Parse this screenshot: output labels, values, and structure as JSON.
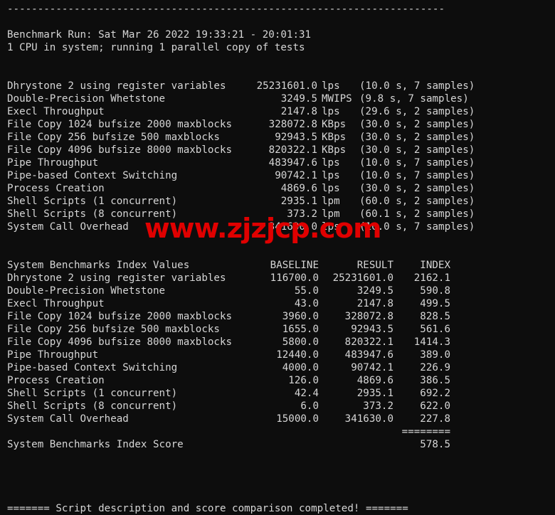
{
  "terminal": {
    "background": "#0d0d0d",
    "foreground": "#d6d6d6",
    "watermark_color": "#e00000",
    "divider_top": "------------------------------------------------------------------------",
    "header": {
      "benchmark_run": "Benchmark Run: Sat Mar 26 2022 19:33:21 - 20:01:31",
      "cpu_line": "1 CPU in system; running 1 parallel copy of tests"
    },
    "watermark": "www.zjzjcp.com",
    "results": [
      {
        "label": "Dhrystone 2 using register variables",
        "value": "25231601.0",
        "unit": "lps",
        "timing": "(10.0 s, 7 samples)"
      },
      {
        "label": "Double-Precision Whetstone",
        "value": "3249.5",
        "unit": "MWIPS",
        "timing": "(9.8 s, 7 samples)"
      },
      {
        "label": "Execl Throughput",
        "value": "2147.8",
        "unit": "lps",
        "timing": "(29.6 s, 2 samples)"
      },
      {
        "label": "File Copy 1024 bufsize 2000 maxblocks",
        "value": "328072.8",
        "unit": "KBps",
        "timing": "(30.0 s, 2 samples)"
      },
      {
        "label": "File Copy 256 bufsize 500 maxblocks",
        "value": "92943.5",
        "unit": "KBps",
        "timing": "(30.0 s, 2 samples)"
      },
      {
        "label": "File Copy 4096 bufsize 8000 maxblocks",
        "value": "820322.1",
        "unit": "KBps",
        "timing": "(30.0 s, 2 samples)"
      },
      {
        "label": "Pipe Throughput",
        "value": "483947.6",
        "unit": "lps",
        "timing": "(10.0 s, 7 samples)"
      },
      {
        "label": "Pipe-based Context Switching",
        "value": "90742.1",
        "unit": "lps",
        "timing": "(10.0 s, 7 samples)"
      },
      {
        "label": "Process Creation",
        "value": "4869.6",
        "unit": "lps",
        "timing": "(30.0 s, 2 samples)"
      },
      {
        "label": "Shell Scripts (1 concurrent)",
        "value": "2935.1",
        "unit": "lpm",
        "timing": "(60.0 s, 2 samples)"
      },
      {
        "label": "Shell Scripts (8 concurrent)",
        "value": "373.2",
        "unit": "lpm",
        "timing": "(60.1 s, 2 samples)"
      },
      {
        "label": "System Call Overhead",
        "value": "341630.0",
        "unit": "lps",
        "timing": "(10.0 s, 7 samples)"
      }
    ],
    "index_table": {
      "title": "System Benchmarks Index Values",
      "columns": {
        "baseline": "BASELINE",
        "result": "RESULT",
        "index": "INDEX"
      },
      "rows": [
        {
          "label": "Dhrystone 2 using register variables",
          "baseline": "116700.0",
          "result": "25231601.0",
          "index": "2162.1"
        },
        {
          "label": "Double-Precision Whetstone",
          "baseline": "55.0",
          "result": "3249.5",
          "index": "590.8"
        },
        {
          "label": "Execl Throughput",
          "baseline": "43.0",
          "result": "2147.8",
          "index": "499.5"
        },
        {
          "label": "File Copy 1024 bufsize 2000 maxblocks",
          "baseline": "3960.0",
          "result": "328072.8",
          "index": "828.5"
        },
        {
          "label": "File Copy 256 bufsize 500 maxblocks",
          "baseline": "1655.0",
          "result": "92943.5",
          "index": "561.6"
        },
        {
          "label": "File Copy 4096 bufsize 8000 maxblocks",
          "baseline": "5800.0",
          "result": "820322.1",
          "index": "1414.3"
        },
        {
          "label": "Pipe Throughput",
          "baseline": "12440.0",
          "result": "483947.6",
          "index": "389.0"
        },
        {
          "label": "Pipe-based Context Switching",
          "baseline": "4000.0",
          "result": "90742.1",
          "index": "226.9"
        },
        {
          "label": "Process Creation",
          "baseline": "126.0",
          "result": "4869.6",
          "index": "386.5"
        },
        {
          "label": "Shell Scripts (1 concurrent)",
          "baseline": "42.4",
          "result": "2935.1",
          "index": "692.2"
        },
        {
          "label": "Shell Scripts (8 concurrent)",
          "baseline": "6.0",
          "result": "373.2",
          "index": "622.0"
        },
        {
          "label": "System Call Overhead",
          "baseline": "15000.0",
          "result": "341630.0",
          "index": "227.8"
        }
      ],
      "separator": "========",
      "score_label": "System Benchmarks Index Score",
      "score_value": "578.5"
    },
    "footer": "======= Script description and score comparison completed! ======="
  }
}
